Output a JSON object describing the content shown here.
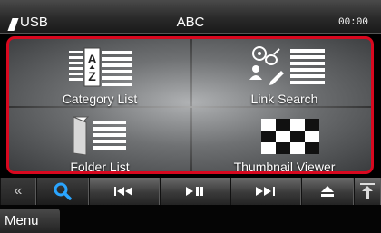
{
  "status_bar": {
    "source": "USB",
    "title": "ABC",
    "clock": "00:00"
  },
  "grid": {
    "items": [
      {
        "label": "Category List",
        "icon": "category-list-icon"
      },
      {
        "label": "Link Search",
        "icon": "link-search-icon"
      },
      {
        "label": "Folder List",
        "icon": "folder-list-icon"
      },
      {
        "label": "Thumbnail Viewer",
        "icon": "thumbnail-viewer-icon"
      }
    ]
  },
  "controls": {
    "buttons": [
      "collapse-icon",
      "search-icon",
      "previous-track-icon",
      "play-pause-icon",
      "next-track-icon",
      "eject-icon",
      "open-panel-icon"
    ]
  },
  "menu": {
    "label": "Menu"
  },
  "colors": {
    "highlight": "#d8081f",
    "search": "#2aa5ff"
  }
}
